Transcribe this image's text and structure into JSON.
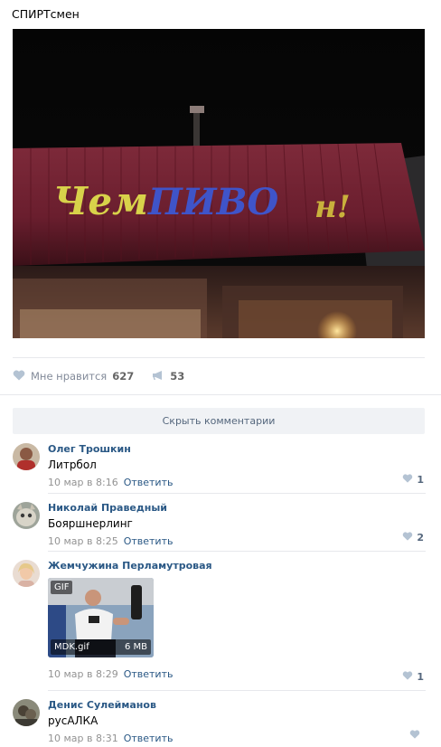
{
  "post": {
    "text": "СПИРТсмен",
    "image_sign": {
      "part1": "Чем",
      "part2": "ПИВО",
      "part3": "н!"
    }
  },
  "actions": {
    "like_label": "Мне нравится",
    "like_count": "627",
    "share_count": "53"
  },
  "hide_comments_label": "Скрыть комментарии",
  "comments": [
    {
      "author": "Олег Трошкин",
      "text": "Литрбол",
      "time": "10 мар в 8:16",
      "reply": "Ответить",
      "likes": "1"
    },
    {
      "author": "Николай Праведный",
      "text": "Бояршнерлинг",
      "time": "10 мар в 8:25",
      "reply": "Ответить",
      "likes": "2"
    },
    {
      "author": "Жемчужина Перламутровая",
      "text": "",
      "time": "10 мар в 8:29",
      "reply": "Ответить",
      "likes": "1",
      "attachment": {
        "badge": "GIF",
        "name": "MDK.gif",
        "size": "6 MB"
      }
    },
    {
      "author": "Денис Сулейманов",
      "text": "русАЛКА",
      "time": "10 мар в 8:31",
      "reply": "Ответить",
      "likes": ""
    }
  ],
  "colors": {
    "link": "#2a5885",
    "muted": "#939393",
    "icon": "#b4c3d3"
  }
}
